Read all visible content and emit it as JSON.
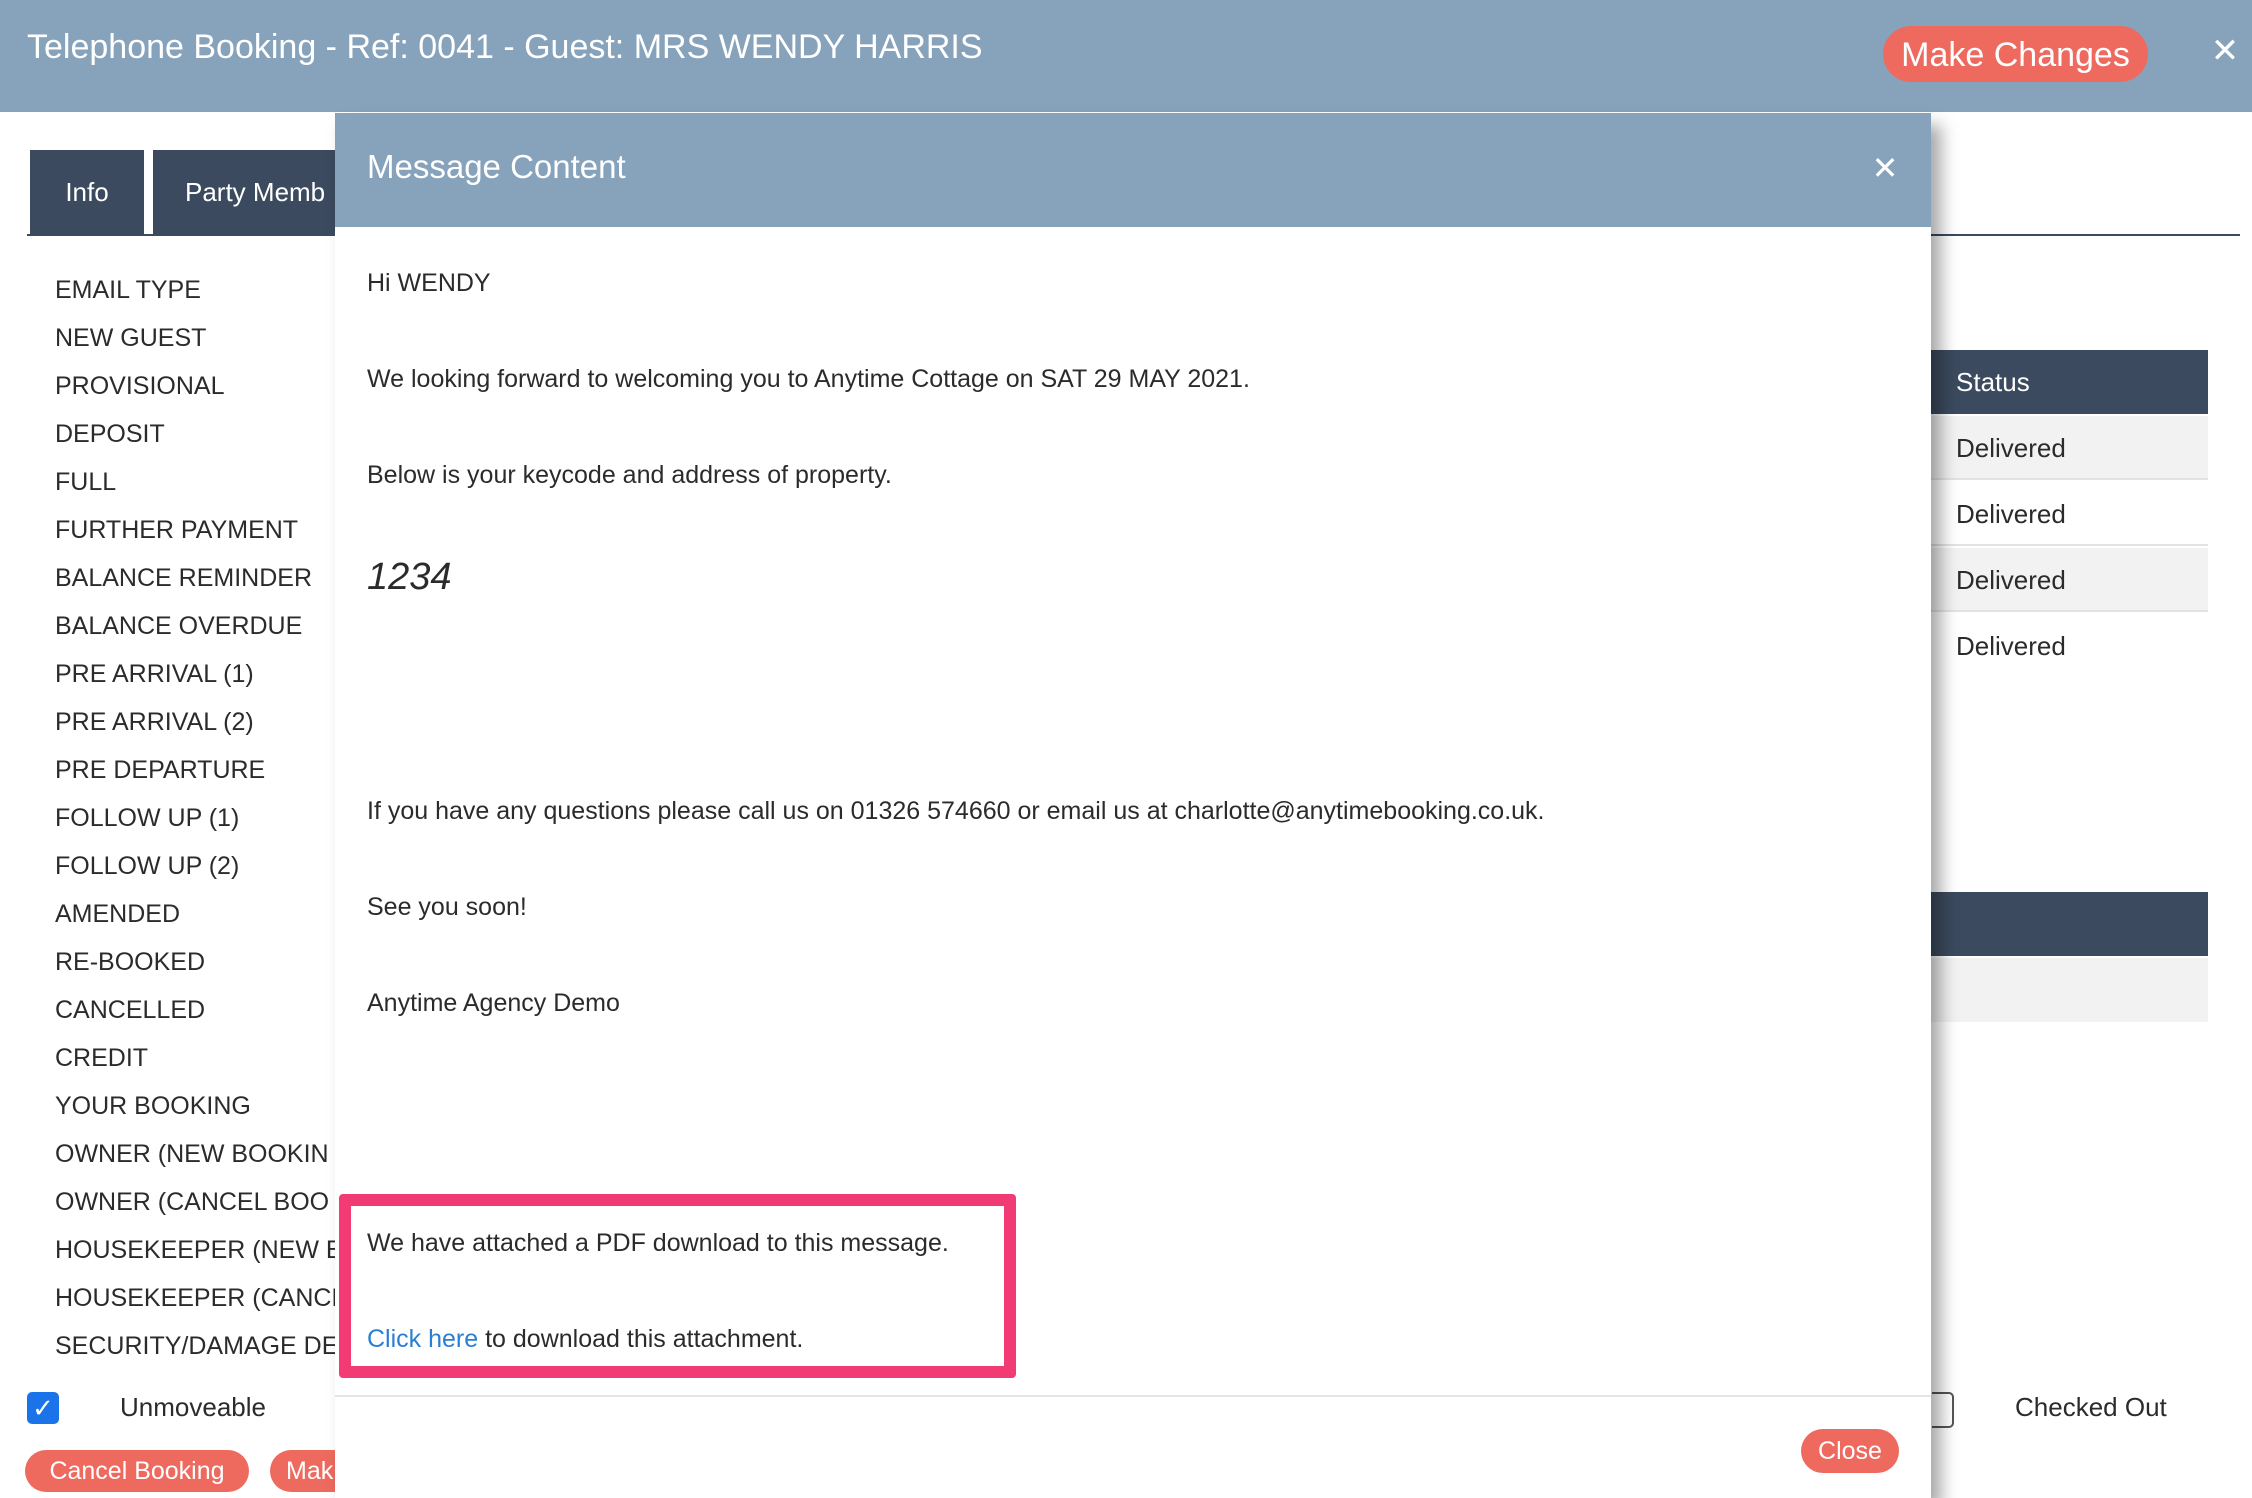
{
  "header": {
    "title": "Telephone Booking - Ref: 0041 - Guest: MRS WENDY HARRIS",
    "make_changes_label": "Make Changes",
    "close_glyph": "✕"
  },
  "tabs": [
    {
      "label": "Info"
    },
    {
      "label": "Party Memb"
    }
  ],
  "email_types": [
    "EMAIL TYPE",
    "NEW GUEST",
    "PROVISIONAL",
    "DEPOSIT",
    "FULL",
    "FURTHER PAYMENT",
    "BALANCE REMINDER",
    "BALANCE OVERDUE",
    "PRE ARRIVAL (1)",
    "PRE ARRIVAL (2)",
    "PRE DEPARTURE",
    "FOLLOW UP (1)",
    "FOLLOW UP (2)",
    "AMENDED",
    "RE-BOOKED",
    "CANCELLED",
    "CREDIT",
    "YOUR BOOKING",
    "OWNER (NEW BOOKIN",
    "OWNER (CANCEL BOO",
    "HOUSEKEEPER (NEW B",
    "HOUSEKEEPER (CANCE",
    "SECURITY/DAMAGE DE"
  ],
  "status_table": {
    "header": "Status",
    "rows": [
      "Delivered",
      "Delivered",
      "Delivered",
      "Delivered"
    ]
  },
  "footer": {
    "unmoveable_label": "Unmoveable",
    "checked_out_label": "Checked Out",
    "cancel_booking_label": "Cancel Booking",
    "make_label": "Mak",
    "checkmark": "✓"
  },
  "modal": {
    "title": "Message Content",
    "close_glyph": "✕",
    "greeting": "Hi WENDY",
    "line1": "We looking forward to welcoming you to Anytime Cottage on SAT 29 MAY 2021.",
    "line2": "Below is your keycode and address of property.",
    "keycode": "1234",
    "line3": "If you have any questions please call us on 01326 574660 or email us at charlotte@anytimebooking.co.uk.",
    "line4": "See you soon!",
    "signature": "Anytime Agency Demo",
    "attachment_text": "We have attached a PDF download to this message.",
    "link_text": "Click here",
    "link_suffix": " to download this attachment.",
    "close_button_label": "Close"
  },
  "colors": {
    "header_bg": "#87a2bb",
    "dark_navy": "#3b4a5e",
    "accent_red": "#ee6a5f",
    "highlight_pink": "#f23a74",
    "link_blue": "#2a7fd4"
  }
}
